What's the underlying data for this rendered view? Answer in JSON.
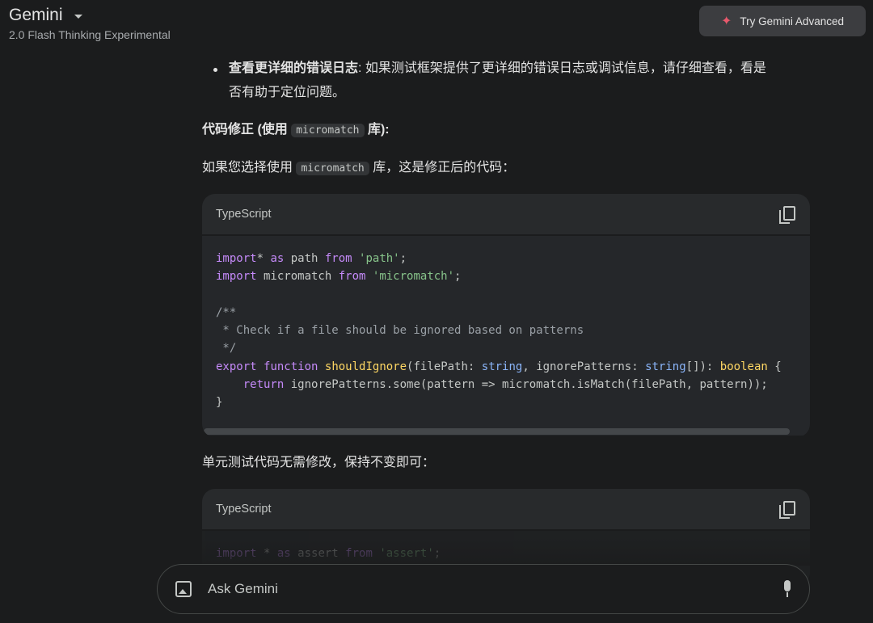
{
  "header": {
    "title": "Gemini",
    "subtitle": "2.0 Flash Thinking Experimental",
    "try_button": "Try Gemini Advanced"
  },
  "content": {
    "bullet_bold": "查看更详细的错误日志",
    "bullet_text": ": 如果测试框架提供了更详细的错误日志或调试信息，请仔细查看，看是",
    "bullet_text_2": "否有助于定位问题。",
    "heading_prefix": "代码修正 (使用",
    "heading_code": "micromatch",
    "heading_suffix": "库):",
    "para_prefix": "如果您选择使用",
    "para_code": "micromatch",
    "para_suffix": "库，这是修正后的代码：",
    "para2": "单元测试代码无需修改，保持不变即可："
  },
  "code_blocks": [
    {
      "language": "TypeScript",
      "lines": [
        [
          [
            "kw",
            "import"
          ],
          [
            "",
            "* "
          ],
          [
            "kw",
            "as"
          ],
          [
            "",
            " path "
          ],
          [
            "kw",
            "from"
          ],
          [
            "",
            " "
          ],
          [
            "str",
            "'path'"
          ],
          [
            "",
            ";"
          ]
        ],
        [
          [
            "kw",
            "import"
          ],
          [
            "",
            " micromatch "
          ],
          [
            "kw",
            "from"
          ],
          [
            "",
            " "
          ],
          [
            "str",
            "'micromatch'"
          ],
          [
            "",
            ";"
          ]
        ],
        [],
        [
          [
            "cm",
            "/**"
          ]
        ],
        [
          [
            "cm",
            " * Check if a file should be ignored based on patterns"
          ]
        ],
        [
          [
            "cm",
            " */"
          ]
        ],
        [
          [
            "kw",
            "export"
          ],
          [
            "",
            " "
          ],
          [
            "kw",
            "function"
          ],
          [
            "",
            " "
          ],
          [
            "fn",
            "shouldIgnore"
          ],
          [
            "",
            "(filePath: "
          ],
          [
            "ty",
            "string"
          ],
          [
            "",
            ", ignorePatterns: "
          ],
          [
            "ty",
            "string"
          ],
          [
            "",
            "[]): "
          ],
          [
            "fn",
            "boolean"
          ],
          [
            "",
            " {"
          ]
        ],
        [
          [
            "",
            "    "
          ],
          [
            "kw",
            "return"
          ],
          [
            "",
            " ignorePatterns.some(pattern => micromatch.isMatch(filePath, pattern));"
          ]
        ],
        [
          [
            "",
            "}"
          ]
        ]
      ]
    },
    {
      "language": "TypeScript",
      "lines": [
        [
          [
            "kw",
            "import"
          ],
          [
            "",
            " * "
          ],
          [
            "kw",
            "as"
          ],
          [
            "",
            " assert "
          ],
          [
            "kw",
            "from"
          ],
          [
            "",
            " "
          ],
          [
            "str",
            "'assert'"
          ],
          [
            "",
            ";"
          ]
        ]
      ]
    }
  ],
  "input": {
    "placeholder": "Ask Gemini"
  }
}
